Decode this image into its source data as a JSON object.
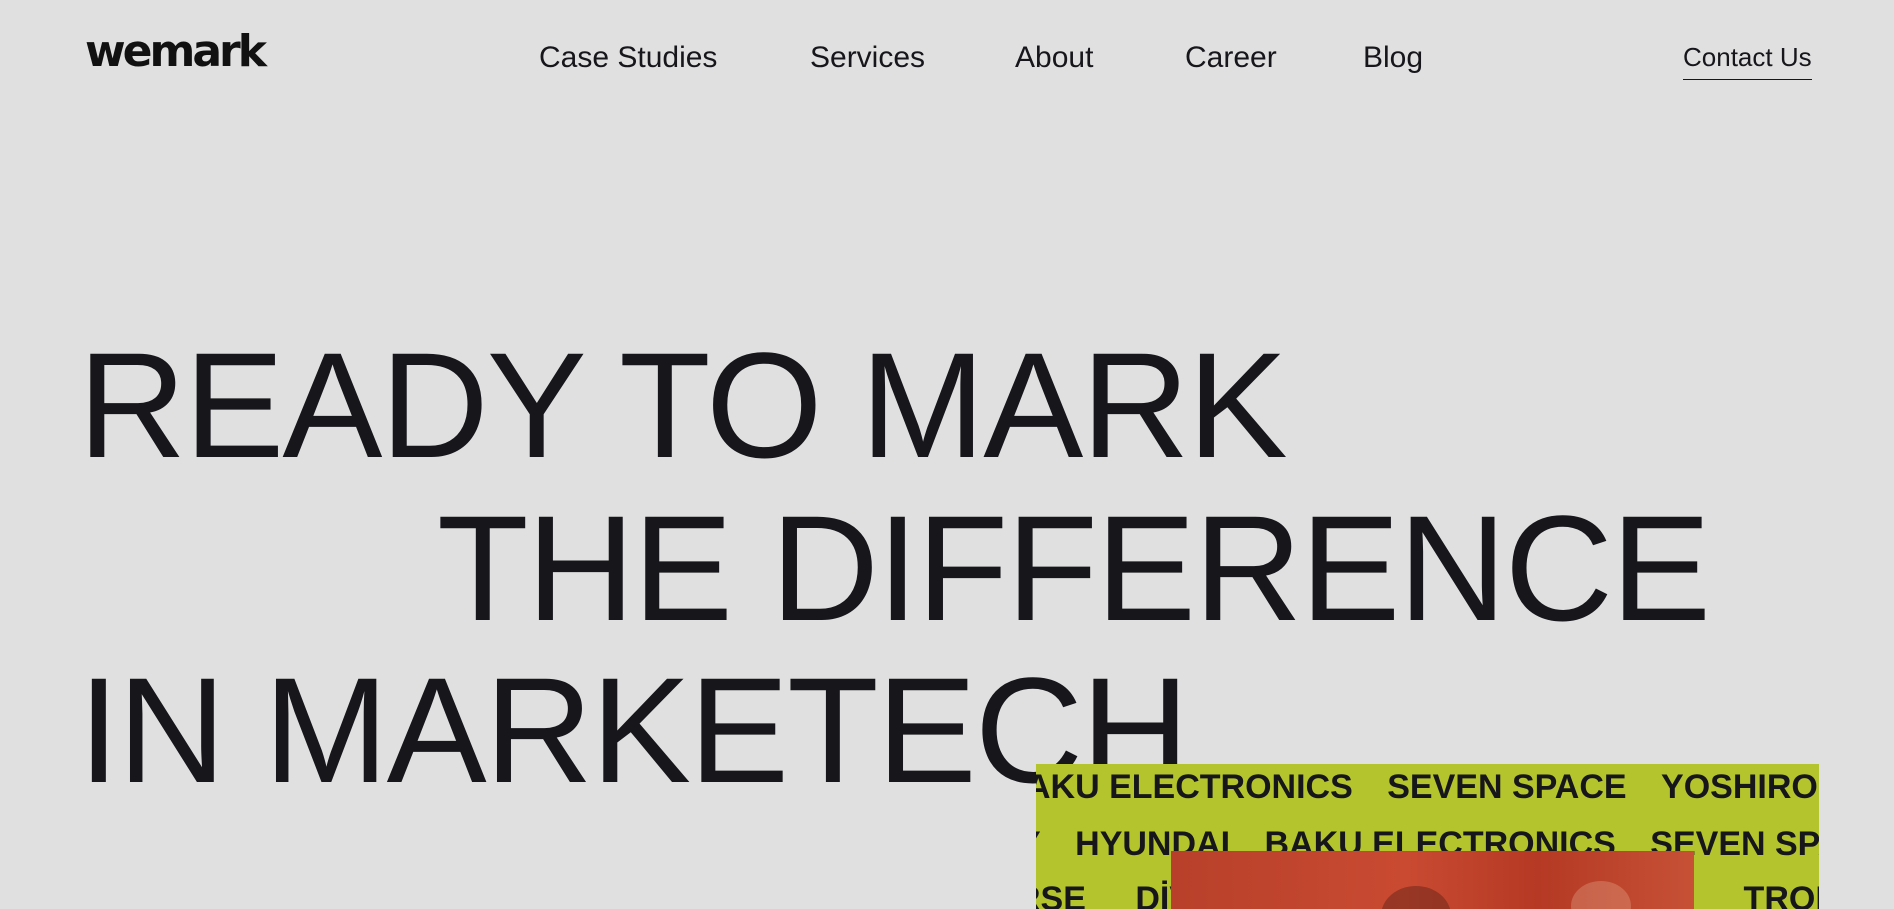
{
  "header": {
    "logo": "wemark",
    "nav": [
      {
        "label": "Case Studies"
      },
      {
        "label": "Services"
      },
      {
        "label": "About"
      },
      {
        "label": "Career"
      },
      {
        "label": "Blog"
      }
    ],
    "contact_label": "Contact Us"
  },
  "hero": {
    "line1": "READY TO MARK",
    "line2": "THE DIFFERENCE",
    "line3": "IN MARKETECH"
  },
  "ticker": {
    "background_color": "#b4c42d",
    "row1": [
      "AKU ELECTRONICS",
      "SEVEN SPACE",
      "YOSHIRO"
    ],
    "row2": [
      "Y",
      "HYUNDAI",
      "BAKU ELECTRONICS",
      "SEVEN SPA"
    ],
    "row3": [
      "RSE",
      "DİVA",
      "TRONICS"
    ]
  },
  "colors": {
    "background": "#e0e0e0",
    "text": "#16161b",
    "accent": "#b4c42d"
  }
}
